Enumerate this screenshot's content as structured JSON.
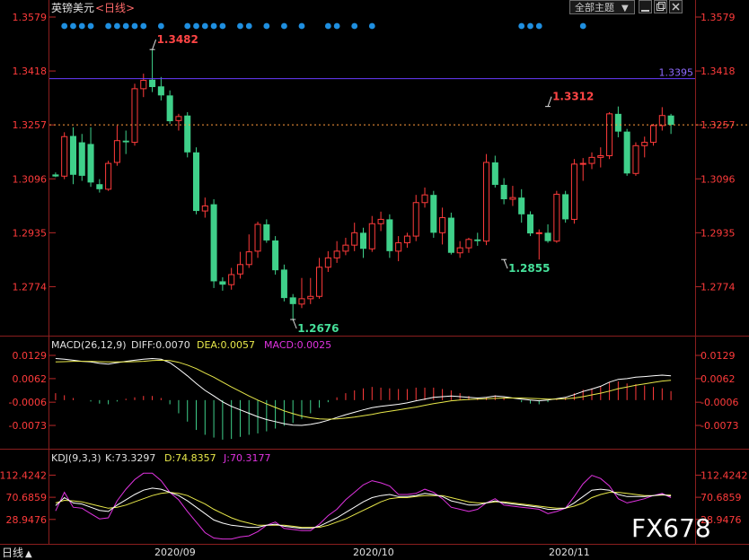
{
  "header": {
    "symbol": "英镑美元",
    "period": "<日线>",
    "theme_button": "全部主题",
    "theme_arrow": "▼"
  },
  "colors": {
    "background": "#000000",
    "up": "#ff3b3b",
    "down": "#3fd08a",
    "axis_text_red": "#ff3b3b",
    "axis_text_white": "#e0e0e0",
    "hline_purple": "#6a3cff",
    "current_price_line": "#ff9a3c",
    "diff_line": "#ffffff",
    "dea_line": "#e8e84a",
    "k_line": "#ffffff",
    "d_line": "#e8e84a",
    "j_line": "#e033e0",
    "signal_dots": "#1f8fe0"
  },
  "footer": {
    "left_label": "日线",
    "left_arrow": "▲",
    "watermark": "FX678",
    "dates": [
      "2020/09",
      "2020/10",
      "2020/11"
    ]
  },
  "chart_data": [
    {
      "type": "candlestick",
      "name": "price",
      "ylim": [
        1.2676,
        1.3579
      ],
      "yticks": [
        1.3579,
        1.3418,
        1.3257,
        1.3096,
        1.2935,
        1.2774
      ],
      "ytick_labels": [
        "1.3579",
        "1.3418",
        "1.3257",
        "1.3096",
        "1.2935",
        "1.2774"
      ],
      "hline_value": 1.3395,
      "hline_label": "1.3395",
      "current_price": 1.3257,
      "annotations": [
        {
          "text": "1.3482",
          "value": 1.3482,
          "index": 11,
          "pos": "high"
        },
        {
          "text": "1.2676",
          "value": 1.2676,
          "index": 27,
          "pos": "low"
        },
        {
          "text": "1.2855",
          "value": 1.2855,
          "index": 51,
          "pos": "low"
        },
        {
          "text": "1.3312",
          "value": 1.3312,
          "index": 56,
          "pos": "high"
        }
      ],
      "signal_dots": [
        1,
        2,
        3,
        4,
        6,
        7,
        8,
        9,
        10,
        12,
        15,
        16,
        17,
        18,
        19,
        21,
        22,
        24,
        26,
        28,
        31,
        32,
        34,
        36,
        53,
        54,
        55,
        60
      ],
      "candles": [
        {
          "o": 1.3109,
          "h": 1.3115,
          "l": 1.3101,
          "c": 1.3103
        },
        {
          "o": 1.3104,
          "h": 1.3235,
          "l": 1.3095,
          "c": 1.3222
        },
        {
          "o": 1.3224,
          "h": 1.325,
          "l": 1.308,
          "c": 1.3108
        },
        {
          "o": 1.3205,
          "h": 1.323,
          "l": 1.309,
          "c": 1.3105
        },
        {
          "o": 1.32,
          "h": 1.325,
          "l": 1.3072,
          "c": 1.3085
        },
        {
          "o": 1.308,
          "h": 1.3095,
          "l": 1.3055,
          "c": 1.3065
        },
        {
          "o": 1.3065,
          "h": 1.315,
          "l": 1.306,
          "c": 1.3142
        },
        {
          "o": 1.3145,
          "h": 1.3255,
          "l": 1.3135,
          "c": 1.321
        },
        {
          "o": 1.321,
          "h": 1.324,
          "l": 1.317,
          "c": 1.3205
        },
        {
          "o": 1.3205,
          "h": 1.338,
          "l": 1.3195,
          "c": 1.3365
        },
        {
          "o": 1.3365,
          "h": 1.341,
          "l": 1.334,
          "c": 1.339
        },
        {
          "o": 1.3392,
          "h": 1.3482,
          "l": 1.3355,
          "c": 1.337
        },
        {
          "o": 1.3372,
          "h": 1.34,
          "l": 1.333,
          "c": 1.3345
        },
        {
          "o": 1.3345,
          "h": 1.336,
          "l": 1.326,
          "c": 1.3268
        },
        {
          "o": 1.327,
          "h": 1.329,
          "l": 1.324,
          "c": 1.3282
        },
        {
          "o": 1.3285,
          "h": 1.3295,
          "l": 1.316,
          "c": 1.3175
        },
        {
          "o": 1.3175,
          "h": 1.319,
          "l": 1.299,
          "c": 1.3
        },
        {
          "o": 1.3,
          "h": 1.304,
          "l": 1.298,
          "c": 1.3015
        },
        {
          "o": 1.302,
          "h": 1.3035,
          "l": 1.277,
          "c": 1.279
        },
        {
          "o": 1.279,
          "h": 1.2802,
          "l": 1.2762,
          "c": 1.278
        },
        {
          "o": 1.278,
          "h": 1.283,
          "l": 1.2765,
          "c": 1.281
        },
        {
          "o": 1.2812,
          "h": 1.2878,
          "l": 1.2798,
          "c": 1.284
        },
        {
          "o": 1.284,
          "h": 1.293,
          "l": 1.283,
          "c": 1.2878
        },
        {
          "o": 1.288,
          "h": 1.2968,
          "l": 1.286,
          "c": 1.296
        },
        {
          "o": 1.296,
          "h": 1.2975,
          "l": 1.2905,
          "c": 1.2912
        },
        {
          "o": 1.2912,
          "h": 1.2925,
          "l": 1.281,
          "c": 1.2823
        },
        {
          "o": 1.2825,
          "h": 1.284,
          "l": 1.273,
          "c": 1.274
        },
        {
          "o": 1.2742,
          "h": 1.2752,
          "l": 1.2676,
          "c": 1.2722
        },
        {
          "o": 1.2722,
          "h": 1.28,
          "l": 1.271,
          "c": 1.2738
        },
        {
          "o": 1.2738,
          "h": 1.28,
          "l": 1.2722,
          "c": 1.2745
        },
        {
          "o": 1.2745,
          "h": 1.286,
          "l": 1.2738,
          "c": 1.2832
        },
        {
          "o": 1.2832,
          "h": 1.288,
          "l": 1.2818,
          "c": 1.286
        },
        {
          "o": 1.286,
          "h": 1.291,
          "l": 1.2845,
          "c": 1.288
        },
        {
          "o": 1.288,
          "h": 1.292,
          "l": 1.2868,
          "c": 1.2898
        },
        {
          "o": 1.2898,
          "h": 1.2965,
          "l": 1.288,
          "c": 1.2935
        },
        {
          "o": 1.2935,
          "h": 1.295,
          "l": 1.286,
          "c": 1.2887
        },
        {
          "o": 1.2887,
          "h": 1.2985,
          "l": 1.2878,
          "c": 1.2962
        },
        {
          "o": 1.2962,
          "h": 1.2998,
          "l": 1.294,
          "c": 1.2975
        },
        {
          "o": 1.2975,
          "h": 1.299,
          "l": 1.286,
          "c": 1.288
        },
        {
          "o": 1.288,
          "h": 1.2925,
          "l": 1.285,
          "c": 1.2905
        },
        {
          "o": 1.2905,
          "h": 1.2935,
          "l": 1.289,
          "c": 1.2925
        },
        {
          "o": 1.2925,
          "h": 1.3048,
          "l": 1.291,
          "c": 1.3025
        },
        {
          "o": 1.3025,
          "h": 1.307,
          "l": 1.301,
          "c": 1.3048
        },
        {
          "o": 1.3048,
          "h": 1.306,
          "l": 1.292,
          "c": 1.2935
        },
        {
          "o": 1.2935,
          "h": 1.301,
          "l": 1.29,
          "c": 1.298
        },
        {
          "o": 1.298,
          "h": 1.2995,
          "l": 1.287,
          "c": 1.2875
        },
        {
          "o": 1.2875,
          "h": 1.291,
          "l": 1.286,
          "c": 1.289
        },
        {
          "o": 1.289,
          "h": 1.292,
          "l": 1.2875,
          "c": 1.2915
        },
        {
          "o": 1.2915,
          "h": 1.2935,
          "l": 1.2896,
          "c": 1.291
        },
        {
          "o": 1.291,
          "h": 1.317,
          "l": 1.2898,
          "c": 1.3145
        },
        {
          "o": 1.3145,
          "h": 1.3165,
          "l": 1.307,
          "c": 1.3078
        },
        {
          "o": 1.3078,
          "h": 1.3098,
          "l": 1.302,
          "c": 1.3035
        },
        {
          "o": 1.3035,
          "h": 1.3075,
          "l": 1.3015,
          "c": 1.304
        },
        {
          "o": 1.304,
          "h": 1.3065,
          "l": 1.2965,
          "c": 1.299
        },
        {
          "o": 1.299,
          "h": 1.2999,
          "l": 1.2925,
          "c": 1.2933
        },
        {
          "o": 1.2933,
          "h": 1.2945,
          "l": 1.2855,
          "c": 1.2935
        },
        {
          "o": 1.2935,
          "h": 1.296,
          "l": 1.2905,
          "c": 1.291
        },
        {
          "o": 1.291,
          "h": 1.306,
          "l": 1.2905,
          "c": 1.305
        },
        {
          "o": 1.305,
          "h": 1.306,
          "l": 1.2965,
          "c": 1.2975
        },
        {
          "o": 1.2975,
          "h": 1.3155,
          "l": 1.2962,
          "c": 1.314
        },
        {
          "o": 1.314,
          "h": 1.3158,
          "l": 1.309,
          "c": 1.3142
        },
        {
          "o": 1.3142,
          "h": 1.3175,
          "l": 1.3125,
          "c": 1.316
        },
        {
          "o": 1.316,
          "h": 1.319,
          "l": 1.313,
          "c": 1.3165
        },
        {
          "o": 1.3165,
          "h": 1.3295,
          "l": 1.3155,
          "c": 1.329
        },
        {
          "o": 1.329,
          "h": 1.3312,
          "l": 1.322,
          "c": 1.3237
        },
        {
          "o": 1.3237,
          "h": 1.3245,
          "l": 1.3105,
          "c": 1.3112
        },
        {
          "o": 1.3112,
          "h": 1.3205,
          "l": 1.3105,
          "c": 1.3195
        },
        {
          "o": 1.3195,
          "h": 1.3222,
          "l": 1.316,
          "c": 1.3205
        },
        {
          "o": 1.3205,
          "h": 1.326,
          "l": 1.3195,
          "c": 1.3255
        },
        {
          "o": 1.3255,
          "h": 1.331,
          "l": 1.324,
          "c": 1.3285
        },
        {
          "o": 1.3285,
          "h": 1.329,
          "l": 1.323,
          "c": 1.3257
        }
      ]
    },
    {
      "type": "line",
      "name": "MACD(26,12,9)",
      "title": "MACD(26,12,9)",
      "readouts": [
        {
          "key": "diff",
          "text": "DIFF:0.0070"
        },
        {
          "key": "dea",
          "text": "DEA:0.0057"
        },
        {
          "key": "macd",
          "text": "MACD:0.0025"
        }
      ],
      "ylim": [
        -0.0135,
        0.0129
      ],
      "yticks": [
        0.0129,
        0.0062,
        -0.0006,
        -0.0073
      ],
      "ytick_labels": [
        "0.0129",
        "0.0062",
        "-0.0006",
        "-0.0073"
      ],
      "series": [
        {
          "name": "DIFF",
          "values": [
            0.012,
            0.0118,
            0.0115,
            0.0112,
            0.011,
            0.0106,
            0.0104,
            0.0108,
            0.0112,
            0.0115,
            0.0118,
            0.012,
            0.0118,
            0.0108,
            0.009,
            0.007,
            0.0048,
            0.0028,
            0.0012,
            -0.0005,
            -0.0018,
            -0.0028,
            -0.0038,
            -0.0048,
            -0.0056,
            -0.0062,
            -0.0068,
            -0.0072,
            -0.0073,
            -0.007,
            -0.0065,
            -0.0058,
            -0.005,
            -0.0042,
            -0.0035,
            -0.0028,
            -0.0022,
            -0.0018,
            -0.0015,
            -0.0012,
            -0.0008,
            -0.0002,
            0.0003,
            0.0008,
            0.001,
            0.0012,
            0.001,
            0.0008,
            0.0006,
            0.0008,
            0.0012,
            0.001,
            0.0006,
            0.0003,
            0.0,
            -0.0002,
            0.0,
            0.0004,
            0.0008,
            0.0016,
            0.0025,
            0.0032,
            0.004,
            0.0052,
            0.006,
            0.0062,
            0.0066,
            0.0068,
            0.007,
            0.0072,
            0.007
          ]
        },
        {
          "name": "DEA",
          "values": [
            0.011,
            0.0111,
            0.0112,
            0.0112,
            0.0112,
            0.0111,
            0.011,
            0.011,
            0.011,
            0.0111,
            0.0112,
            0.0114,
            0.0115,
            0.0114,
            0.0109,
            0.0101,
            0.0091,
            0.0078,
            0.0066,
            0.0052,
            0.0038,
            0.0025,
            0.0012,
            0.0,
            -0.0011,
            -0.0021,
            -0.0031,
            -0.0039,
            -0.0046,
            -0.0051,
            -0.0054,
            -0.0055,
            -0.0054,
            -0.0052,
            -0.0049,
            -0.0045,
            -0.0041,
            -0.0036,
            -0.0032,
            -0.0028,
            -0.0024,
            -0.002,
            -0.0015,
            -0.001,
            -0.0006,
            -0.0002,
            0.0,
            0.0002,
            0.0003,
            0.0004,
            0.0005,
            0.0006,
            0.0006,
            0.0006,
            0.0005,
            0.0004,
            0.0003,
            0.0003,
            0.0004,
            0.0006,
            0.001,
            0.0015,
            0.002,
            0.0026,
            0.0033,
            0.0038,
            0.0043,
            0.0047,
            0.0051,
            0.0055,
            0.0057
          ]
        },
        {
          "name": "MACD",
          "type": "histogram",
          "values": [
            0.002,
            0.0014,
            0.0006,
            0.0,
            -0.0004,
            -0.001,
            -0.0012,
            -0.0004,
            0.0004,
            0.0008,
            0.0012,
            0.0012,
            0.0006,
            -0.0012,
            -0.0038,
            -0.0062,
            -0.0086,
            -0.01,
            -0.0108,
            -0.0114,
            -0.0112,
            -0.0106,
            -0.01,
            -0.0096,
            -0.009,
            -0.0082,
            -0.0074,
            -0.0066,
            -0.0054,
            -0.0038,
            -0.0022,
            -0.0006,
            0.0008,
            0.002,
            0.0028,
            0.0034,
            0.0038,
            0.0036,
            0.0034,
            0.0032,
            0.0032,
            0.0036,
            0.0036,
            0.0036,
            0.0032,
            0.0028,
            0.002,
            0.0012,
            0.0006,
            0.0008,
            0.0014,
            0.0008,
            0.0,
            -0.0006,
            -0.001,
            -0.0012,
            -0.0006,
            0.0002,
            0.0008,
            0.002,
            0.003,
            0.0034,
            0.004,
            0.0052,
            0.0054,
            0.0048,
            0.0046,
            0.0042,
            0.0038,
            0.0034,
            0.0026
          ]
        }
      ]
    },
    {
      "type": "line",
      "name": "KDJ(9,3,3)",
      "title": "KDJ(9,3,3)",
      "readouts": [
        {
          "key": "k",
          "text": "K:73.3297"
        },
        {
          "key": "d",
          "text": "D:74.8357"
        },
        {
          "key": "j",
          "text": "J:70.3177"
        }
      ],
      "ylim": [
        -12,
        125
      ],
      "yticks": [
        112.4242,
        70.6859,
        28.9476
      ],
      "ytick_labels": [
        "112.4242",
        "70.6859",
        "28.9476"
      ],
      "series": [
        {
          "name": "K",
          "values": [
            55,
            70,
            60,
            58,
            52,
            46,
            44,
            56,
            66,
            76,
            84,
            88,
            86,
            80,
            74,
            64,
            52,
            40,
            28,
            22,
            18,
            16,
            14,
            14,
            18,
            20,
            16,
            14,
            12,
            12,
            16,
            24,
            32,
            42,
            52,
            62,
            70,
            74,
            76,
            72,
            72,
            74,
            78,
            76,
            72,
            64,
            60,
            56,
            56,
            60,
            64,
            60,
            58,
            56,
            54,
            52,
            48,
            48,
            50,
            60,
            72,
            84,
            86,
            84,
            76,
            72,
            72,
            72,
            74,
            76,
            73
          ]
        },
        {
          "name": "D",
          "values": [
            60,
            65,
            64,
            62,
            58,
            54,
            50,
            52,
            56,
            62,
            68,
            74,
            78,
            80,
            78,
            74,
            66,
            58,
            48,
            40,
            32,
            26,
            22,
            18,
            18,
            18,
            18,
            16,
            14,
            14,
            14,
            18,
            24,
            30,
            38,
            46,
            54,
            62,
            68,
            70,
            70,
            72,
            74,
            74,
            74,
            70,
            66,
            62,
            60,
            60,
            62,
            62,
            60,
            58,
            56,
            54,
            52,
            50,
            50,
            54,
            60,
            70,
            76,
            80,
            80,
            78,
            76,
            74,
            74,
            75,
            75
          ]
        },
        {
          "name": "J",
          "values": [
            45,
            80,
            52,
            50,
            40,
            30,
            32,
            64,
            86,
            104,
            116,
            116,
            102,
            80,
            66,
            44,
            24,
            4,
            -6,
            -8,
            -8,
            -4,
            -2,
            6,
            18,
            24,
            12,
            10,
            8,
            8,
            20,
            36,
            48,
            66,
            80,
            94,
            102,
            98,
            92,
            76,
            76,
            78,
            86,
            80,
            68,
            52,
            48,
            44,
            48,
            60,
            68,
            56,
            54,
            52,
            50,
            48,
            40,
            44,
            50,
            72,
            96,
            112,
            106,
            92,
            68,
            60,
            64,
            68,
            74,
            78,
            70
          ]
        }
      ]
    }
  ]
}
